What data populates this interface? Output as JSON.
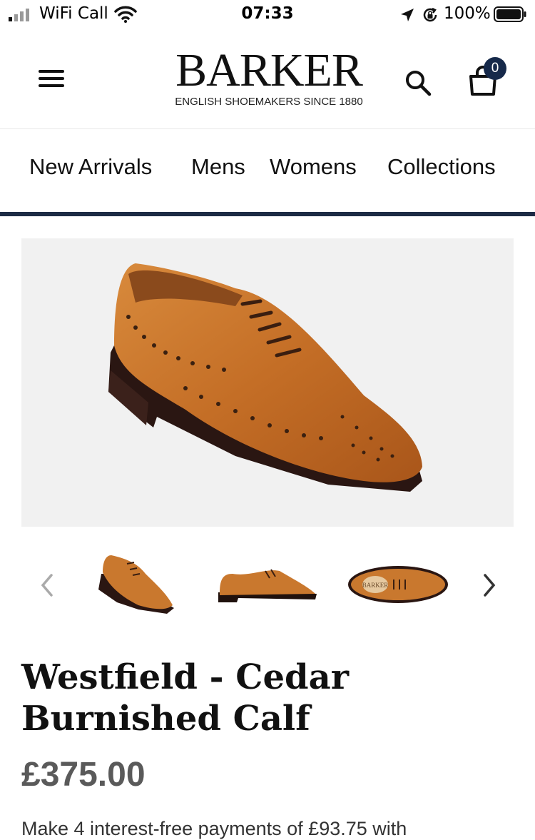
{
  "status_bar": {
    "carrier": "WiFi Call",
    "time": "07:33",
    "battery": "100%",
    "icons": [
      "signal-icon",
      "wifi-icon",
      "location-icon",
      "rotation-lock-icon",
      "battery-icon"
    ]
  },
  "header": {
    "brand_name": "BARKER",
    "brand_tagline": "ENGLISH SHOEMAKERS SINCE 1880",
    "bag_count": "0",
    "icons": [
      "menu-icon",
      "search-icon",
      "shopping-bag-icon"
    ]
  },
  "nav": {
    "items": [
      {
        "label": "New Arrivals"
      },
      {
        "label": "Mens"
      },
      {
        "label": "Womens"
      },
      {
        "label": "Collections"
      }
    ]
  },
  "product": {
    "title": "Westfield - Cedar Burnished Calf",
    "price": "£375.00",
    "installments_text": "Make 4 interest-free payments of £93.75 with",
    "thumbnails": [
      {
        "view": "three-quarter"
      },
      {
        "view": "side"
      },
      {
        "view": "top",
        "insole_text": "BARKER"
      }
    ]
  },
  "colors": {
    "accent_navy": "#16294a",
    "nav_rule": "#1c2b45",
    "price_grey": "#5a5a5a",
    "shoe_tan": "#c9782e"
  }
}
